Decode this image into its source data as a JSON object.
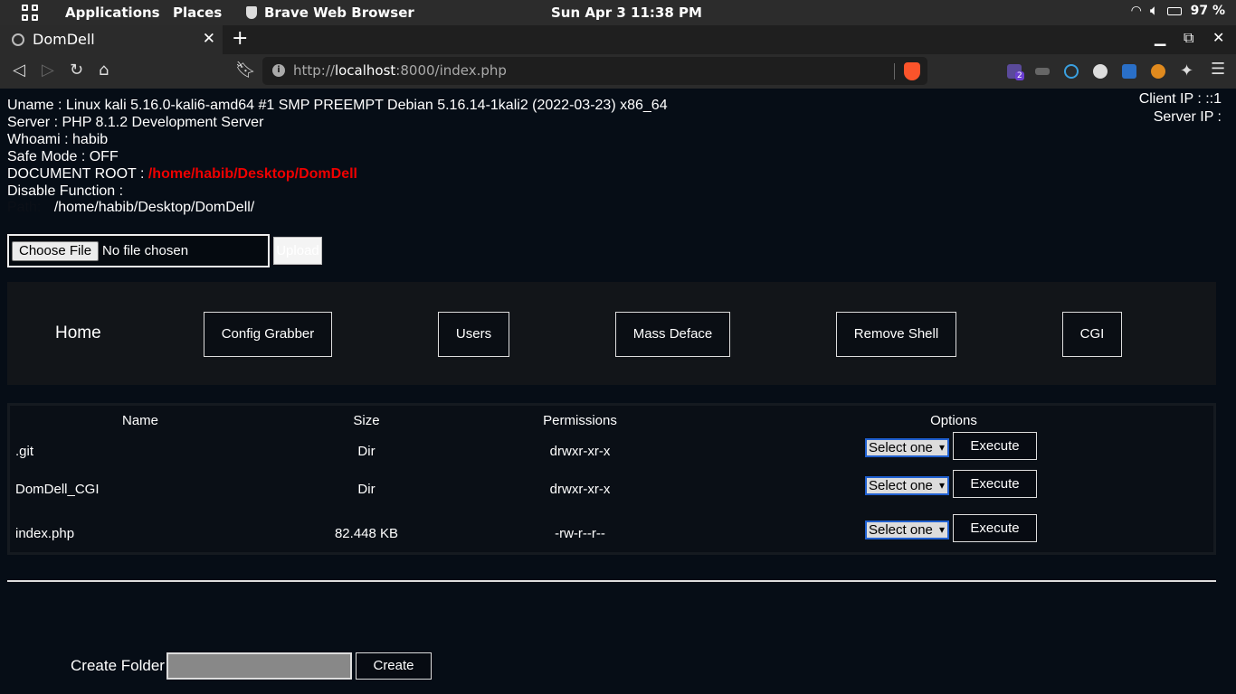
{
  "topbar": {
    "applications": "Applications",
    "places": "Places",
    "browser_app": "Brave Web Browser",
    "clock": "Sun Apr 3  11:38 PM",
    "battery": "97 %"
  },
  "tab": {
    "title": "DomDell"
  },
  "address": {
    "prefix": "http://",
    "host": "localhost",
    "rest": ":8000/index.php"
  },
  "extensions": {
    "badge": "2"
  },
  "info": {
    "uname": "Uname : Linux kali 5.16.0-kali6-amd64 #1 SMP PREEMPT Debian 5.16.14-1kali2 (2022-03-23) x86_64",
    "server": "Server : PHP 8.1.2 Development Server",
    "whoami": "Whoami : habib",
    "safe_mode": "Safe Mode : OFF",
    "doc_root_label": "DOCUMENT ROOT : ",
    "doc_root_value": "/home/habib/Desktop/DomDell",
    "disable_function": "Disable Function :",
    "path_prefix": "Path:",
    "path": "/home/habib/Desktop/DomDell/"
  },
  "ip": {
    "client": "Client IP : ::1",
    "server": "Server IP :"
  },
  "upload": {
    "choose": "Choose File",
    "nofile": "No file chosen",
    "button": "Upload"
  },
  "nav": {
    "home": "Home",
    "config": "Config Grabber",
    "users": "Users",
    "mass": "Mass Deface",
    "remove": "Remove Shell",
    "cgi": "CGI"
  },
  "table": {
    "headers": [
      "Name",
      "Size",
      "Permissions",
      "Options"
    ],
    "rows": [
      {
        "name": ".git",
        "size": "Dir",
        "perm": "drwxr-xr-x",
        "option": "Select one",
        "action": "Execute"
      },
      {
        "name": "DomDell_CGI",
        "size": "Dir",
        "perm": "drwxr-xr-x",
        "option": "Select one",
        "action": "Execute"
      },
      {
        "name": "index.php",
        "size": "82.448 KB",
        "perm": "-rw-r--r--",
        "option": "Select one",
        "action": "Execute"
      }
    ]
  },
  "create": {
    "label": "Create Folder",
    "input_value": "",
    "button": "Create"
  }
}
